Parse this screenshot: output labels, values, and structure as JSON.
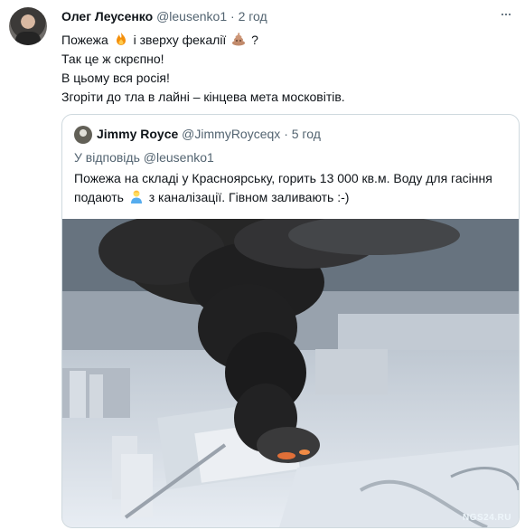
{
  "author": {
    "name": "Олег Леусенко",
    "handle": "@leusenko1",
    "separator": "·",
    "time": "2 год",
    "avatar_icon": "profile-photo"
  },
  "tweet": {
    "line1_before": "Пожежа",
    "line1_fire_icon": "fire-emoji",
    "line1_middle": "і зверху фекалії",
    "line1_poo_icon": "poo-emoji",
    "line1_after": "?",
    "line2": "Так це ж скрєпно!",
    "line3": "В цьому вся росія!",
    "line4": "Згоріти до тла в лайні – кінцева мета московітів."
  },
  "quote": {
    "name": "Jimmy Royce",
    "handle": "@JimmyRoyceqx",
    "separator": "·",
    "time": "5 год",
    "reply_prefix": "У відповідь",
    "reply_mention": "@leusenko1",
    "text_before": "Пожежа на складі у Красноярську, горить 13 000 кв.м. Воду для гасіння подають",
    "text_icon": "person-emoji",
    "text_after": "з каналізації. Гівном заливають :-)",
    "image_watermark": "NGS24.RU"
  },
  "colors": {
    "text": "#0f1419",
    "secondary": "#536471",
    "border": "#cfd9de"
  }
}
